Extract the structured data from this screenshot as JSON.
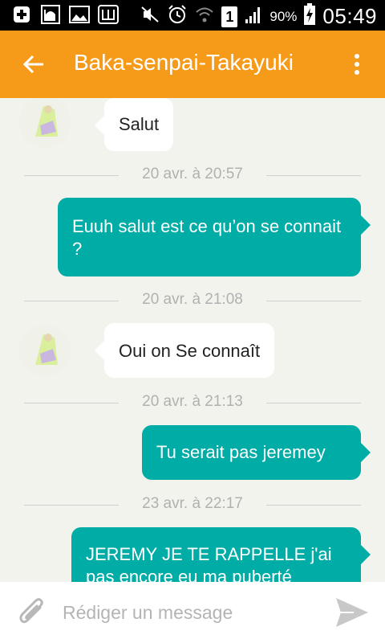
{
  "status_bar": {
    "battery_percent": "90%",
    "time": "05:49",
    "sim_slot": "1",
    "left_icons": [
      "plus-box-icon",
      "mosque-icon",
      "image-icon",
      "w-icon"
    ],
    "right_icons": [
      "mute-icon",
      "alarm-icon",
      "wifi-icon",
      "sim-icon",
      "signal-icon",
      "battery-icon"
    ]
  },
  "header": {
    "title": "Baka-senpai-Takayuki",
    "background": "#f69a1a"
  },
  "messages": [
    {
      "type": "in",
      "text": "Salut"
    },
    {
      "type": "divider",
      "text": "20 avr. à 20:57"
    },
    {
      "type": "out",
      "text": "Euuh salut est ce qu’on se connait ?"
    },
    {
      "type": "divider",
      "text": "20 avr. à 21:08"
    },
    {
      "type": "in",
      "text": "Oui on Se connaît"
    },
    {
      "type": "divider",
      "text": "20 avr. à 21:13"
    },
    {
      "type": "out",
      "text": "Tu serait pas jeremey"
    },
    {
      "type": "divider",
      "text": "23 avr. à 22:17"
    },
    {
      "type": "out",
      "text": "JEREMY JE TE RAPPELLE j'ai pas encore eu ma puberté"
    }
  ],
  "composer": {
    "placeholder": "Rédiger un message"
  },
  "colors": {
    "outgoing_bubble": "#00aca6",
    "incoming_bubble": "#ffffff",
    "chat_background": "#f3f3ee"
  }
}
